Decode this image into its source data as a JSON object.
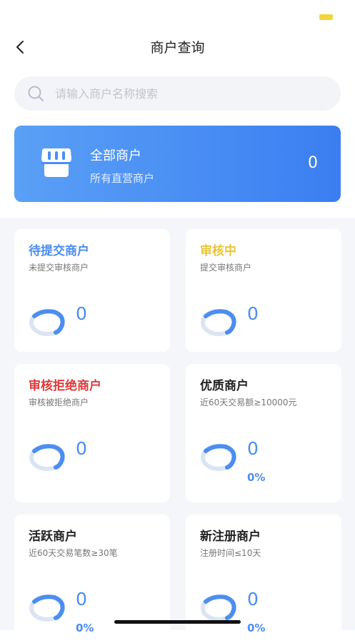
{
  "nav": {
    "title": "商户查询",
    "back_icon": "chevron-left-icon"
  },
  "search": {
    "placeholder": "请输入商户名称搜索",
    "icon": "search-icon"
  },
  "hero": {
    "title": "全部商户",
    "subtitle": "所有直营商户",
    "count": "0",
    "icon": "shop-icon"
  },
  "colors": {
    "blue": "#4b8ef0",
    "yellow": "#e8c53a",
    "red": "#e03a3a",
    "dark": "#222222",
    "ring_bg": "#dbe4f3"
  },
  "cards": [
    {
      "title": "待提交商户",
      "subtitle": "未提交审核商户",
      "count": "0",
      "title_color": "#4b8ef0"
    },
    {
      "title": "审核中",
      "subtitle": "提交审核商户",
      "count": "0",
      "title_color": "#e8c53a"
    },
    {
      "title": "审核拒绝商户",
      "subtitle": "审核被拒绝商户",
      "count": "0",
      "title_color": "#e03a3a"
    },
    {
      "title": "优质商户",
      "subtitle": "近60天交易额≥10000元",
      "count": "0",
      "percent": "0%",
      "title_color": "#222222"
    },
    {
      "title": "活跃商户",
      "subtitle": "近60天交易笔数≥30笔",
      "count": "0",
      "percent": "0%",
      "title_color": "#222222"
    },
    {
      "title": "新注册商户",
      "subtitle": "注册时间≤10天",
      "count": "0",
      "percent": "0%",
      "title_color": "#222222"
    }
  ]
}
